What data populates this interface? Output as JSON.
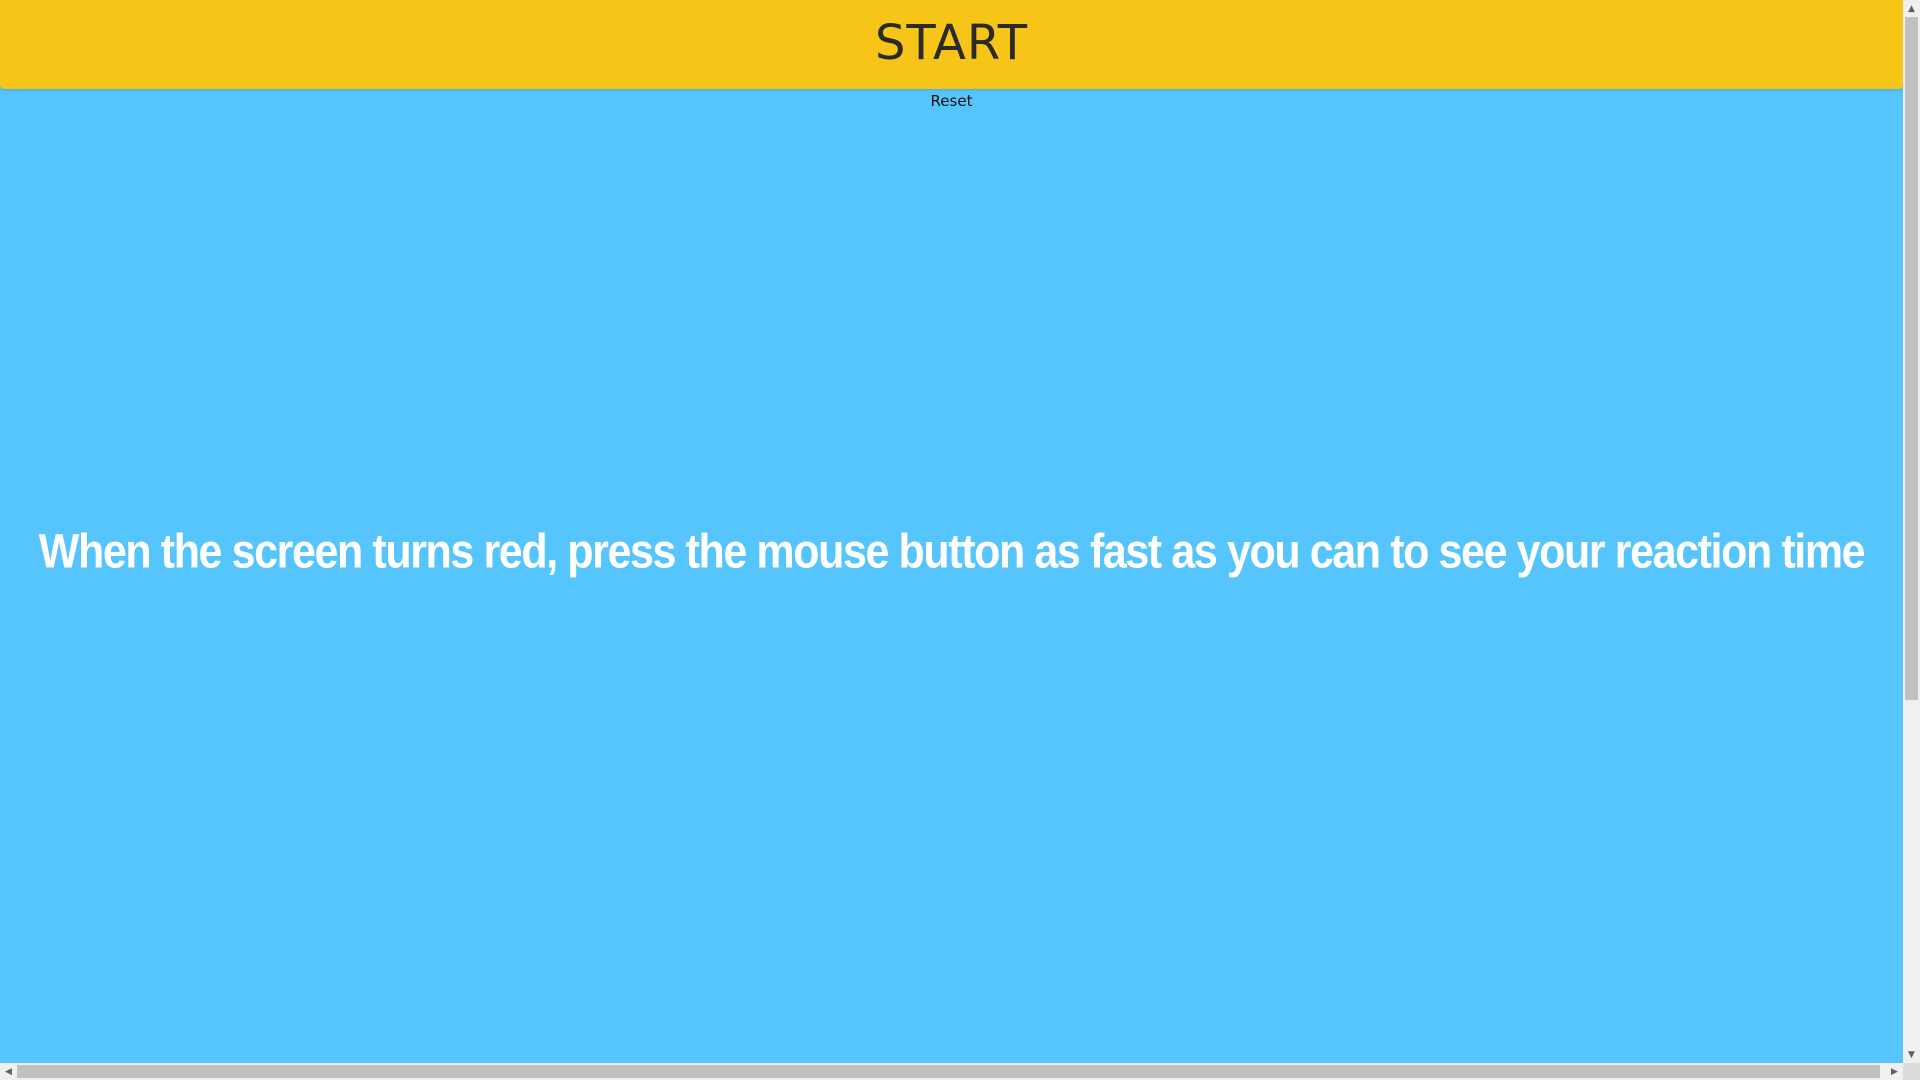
{
  "header": {
    "start_label": "START"
  },
  "controls": {
    "reset_label": "Reset"
  },
  "main": {
    "instructions": "When the screen turns red, press the mouse button as fast as you can to see your reaction time"
  },
  "scrollbars": {
    "up_arrow": "▲",
    "down_arrow": "▼",
    "left_arrow": "◀",
    "right_arrow": "▶"
  },
  "colors": {
    "background": "#56c5fd",
    "start_bar": "#f7c518",
    "instruction_text": "#ffffff"
  }
}
